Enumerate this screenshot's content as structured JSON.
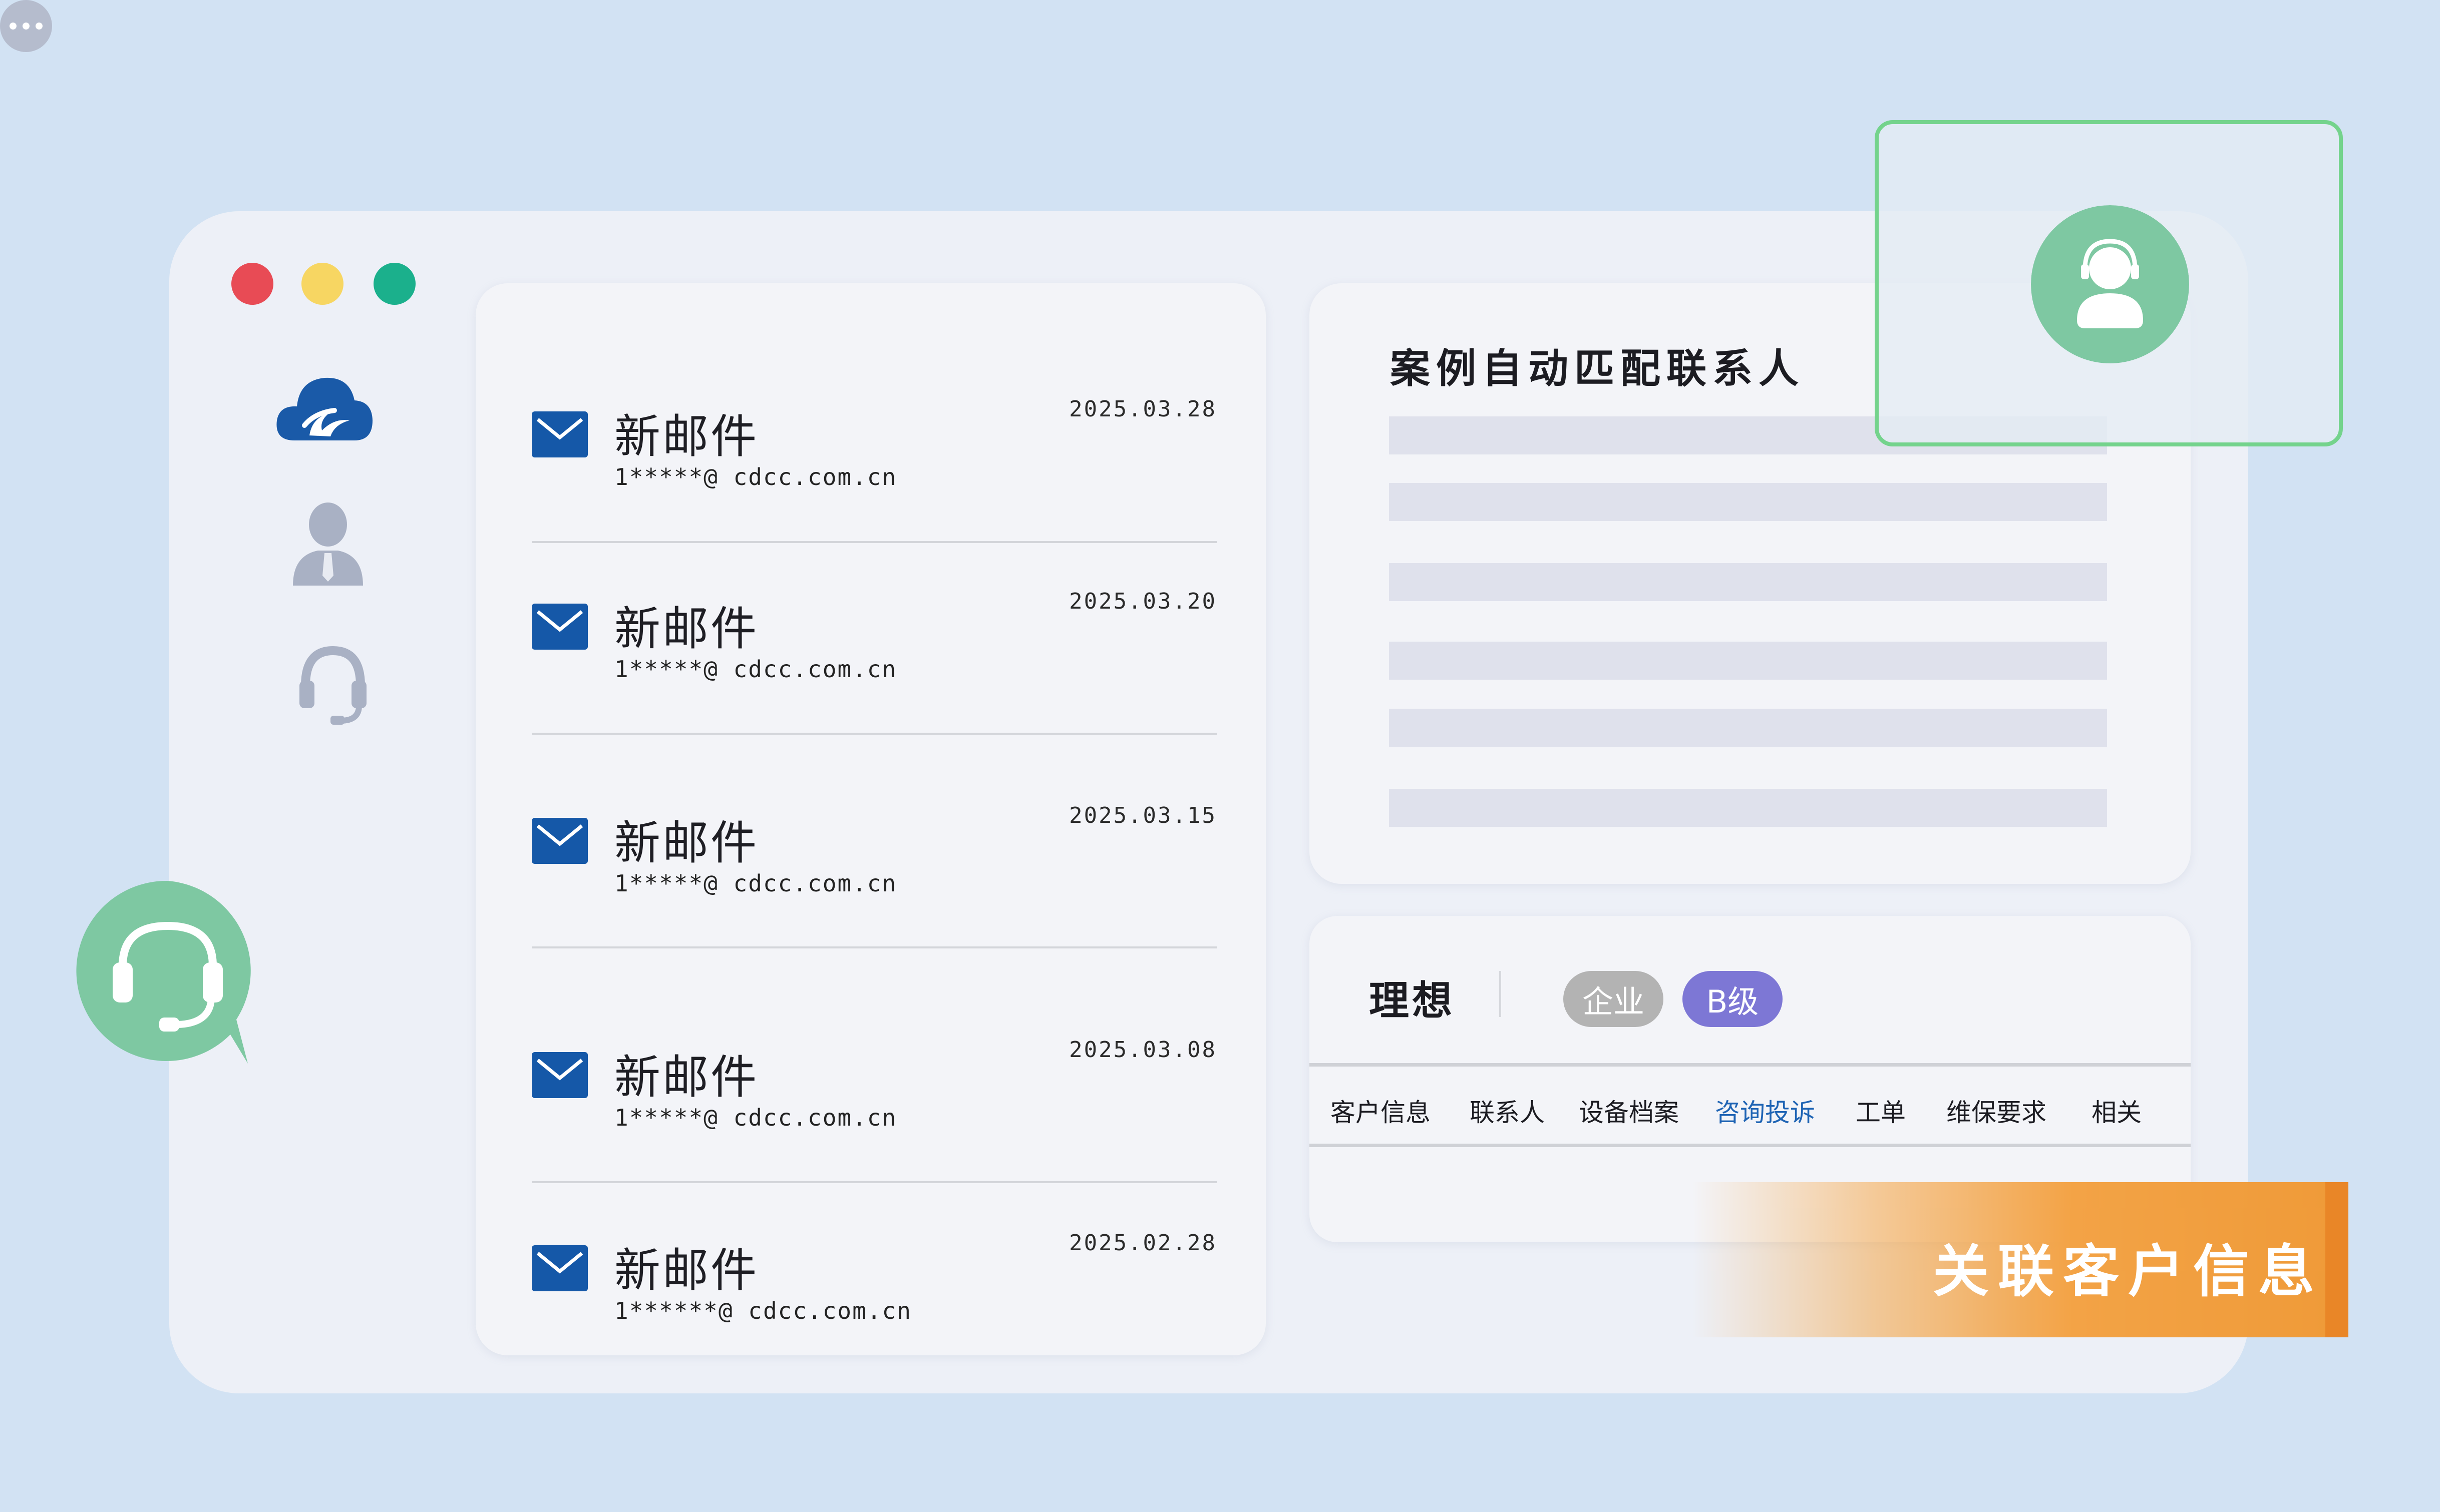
{
  "window": {
    "controls": [
      "close",
      "minimize",
      "maximize"
    ]
  },
  "sidebar": {
    "icons": [
      "cloud-logo-icon",
      "user-icon",
      "headset-icon",
      "more-icon"
    ]
  },
  "mail_list": {
    "items": [
      {
        "title": "新邮件",
        "address": "1*****@ cdcc.com.cn",
        "date": "2025.03.28"
      },
      {
        "title": "新邮件",
        "address": "1*****@ cdcc.com.cn",
        "date": "2025.03.20"
      },
      {
        "title": "新邮件",
        "address": "1*****@ cdcc.com.cn",
        "date": "2025.03.15"
      },
      {
        "title": "新邮件",
        "address": "1*****@ cdcc.com.cn",
        "date": "2025.03.08"
      },
      {
        "title": "新邮件",
        "address": "1******@ cdcc.com.cn",
        "date": "2025.02.28"
      }
    ]
  },
  "case_panel": {
    "title": "案例自动匹配联系人"
  },
  "customer_panel": {
    "name": "理想",
    "badges": {
      "type": "企业",
      "grade": "B级"
    },
    "tabs": [
      "客户信息",
      "联系人",
      "设备档案",
      "咨询投诉",
      "工单",
      "维保要求",
      "相关"
    ],
    "active_tab": "咨询投诉"
  },
  "banner": {
    "text": "关联客户信息"
  },
  "colors": {
    "background": "#d2e2f3",
    "window": "#edf0f7",
    "accent_blue": "#1558a8",
    "active_tab": "#1f64b4",
    "badge_grade": "#7d77d5",
    "badge_type": "#b3b3b3",
    "contact_border": "#74d38c",
    "support_green": "#7ec8a2",
    "banner_orange": "#ef9a38"
  }
}
